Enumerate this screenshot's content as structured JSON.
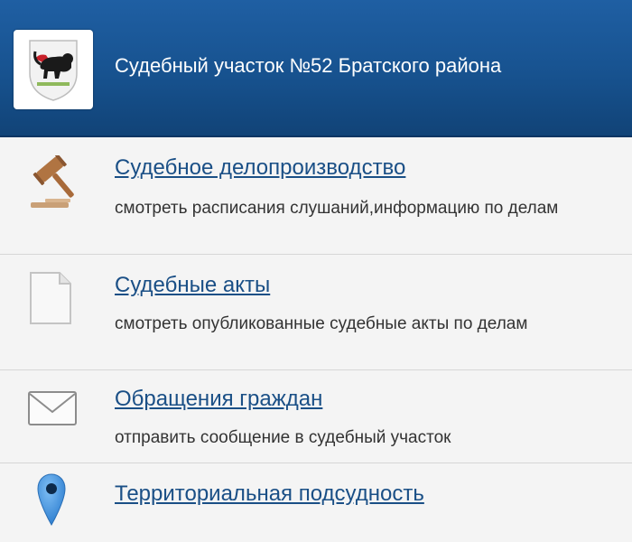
{
  "header": {
    "title": "Судебный участок №52 Братского района",
    "emblem_icon": "irkutsk-coat-of-arms-icon"
  },
  "items": [
    {
      "title": "Судебное делопроизводство",
      "description": "смотреть расписания слушаний,информацию по делам",
      "icon": "gavel-icon"
    },
    {
      "title": "Судебные акты",
      "description": "смотреть опубликованные судебные акты по делам",
      "icon": "document-icon"
    },
    {
      "title": "Обращения граждан",
      "description": "отправить сообщение в судебный участок",
      "icon": "envelope-icon"
    },
    {
      "title": "Территориальная подсудность",
      "icon": "map-pin-icon"
    }
  ],
  "colors": {
    "header_bg": "#17528f",
    "link": "#1a4f86",
    "text": "#333333",
    "pin": "#2f7fd0"
  }
}
